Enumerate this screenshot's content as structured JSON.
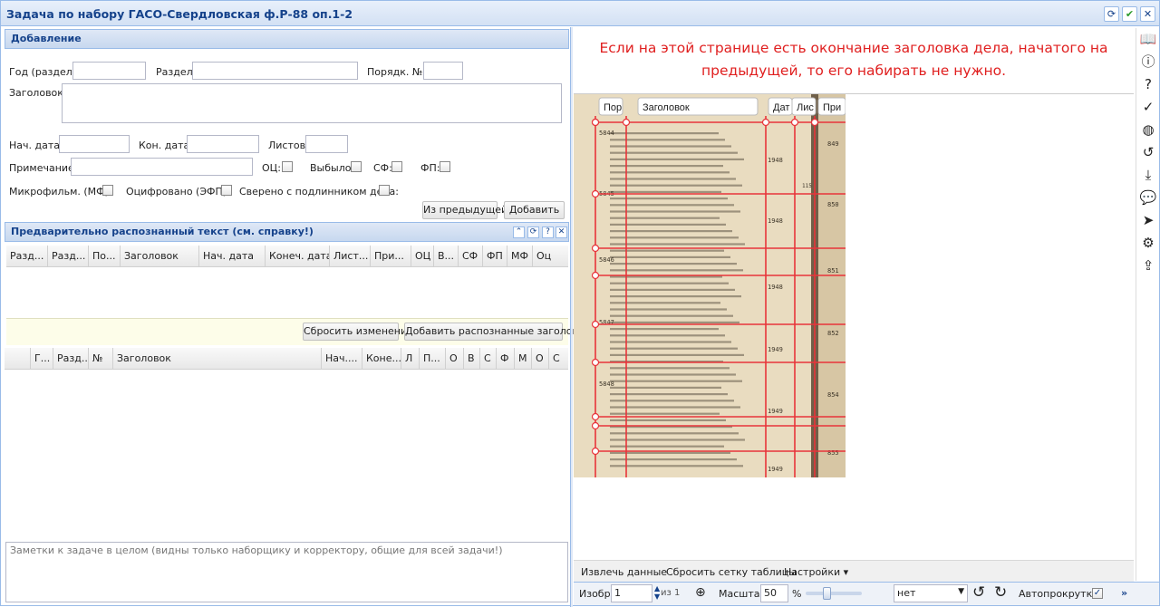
{
  "window": {
    "title": "Задача по набору ГАСО-Свердловская ф.Р-88 оп.1-2",
    "refresh": "⟳",
    "ok": "✔",
    "close": "✕"
  },
  "add": {
    "header": "Добавление",
    "year_label": "Год (раздел):",
    "section_label": "Раздел:",
    "order_label": "Порядк. №:",
    "title_label": "Заголовок:",
    "start_label": "Нач. дата:",
    "end_label": "Кон. дата:",
    "sheets_label": "Листов:",
    "note_label": "Примечание:",
    "oc_label": "ОЦ:",
    "gone_label": "Выбыло:",
    "sf_label": "СФ:",
    "fp_label": "ФП:",
    "mf_label": "Микрофильм. (МФ):",
    "efp_label": "Оцифровано (ЭФП):",
    "verified_label": "Сверено с подлинником дела:",
    "from_prev": "Из предыдущей",
    "add_btn": "Добавить"
  },
  "recognized": {
    "header": "Предварительно распознанный текст (см. справку!)",
    "columns": [
      "Разд...",
      "Разд...",
      "По...",
      "Заголовок",
      "Нач. дата",
      "Конеч. дата",
      "Лист...",
      "При...",
      "ОЦ",
      "В...",
      "СФ",
      "ФП",
      "МФ",
      "Оц"
    ],
    "reset": "Сбросить изменения",
    "add_recognized": "Добавить распознанные заголовки"
  },
  "list": {
    "columns": [
      "Г...",
      "Разд...",
      "№",
      "Заголовок",
      "Нач....",
      "Коне...",
      "Л",
      "П...",
      "О",
      "В",
      "С",
      "Ф",
      "М",
      "О",
      "С"
    ]
  },
  "notes": {
    "placeholder": "Заметки к задаче в целом (видны только наборщику и корректору, общие для всей задачи!)"
  },
  "notice": {
    "line1": "Если на этой странице есть окончание заголовка дела, начатого на",
    "line2": "предыдущей, то его набирать не нужно."
  },
  "image": {
    "col_labels": [
      "Пор",
      "Заголовок",
      "Дат",
      "Лис",
      "При"
    ],
    "entries": [
      {
        "num": "5844",
        "year": "1948",
        "sheets": "115",
        "ref": "849"
      },
      {
        "num": "5845",
        "year": "1948",
        "sheets": "",
        "ref": "850"
      },
      {
        "num": "5846",
        "year": "1948",
        "sheets": "",
        "ref": "851"
      },
      {
        "num": "5847",
        "year": "1949",
        "sheets": "",
        "ref": "852"
      },
      {
        "num": "5848",
        "year": "1949",
        "sheets": "",
        "ref": "854"
      },
      {
        "num": "",
        "year": "1949",
        "sheets": "",
        "ref": "855"
      }
    ]
  },
  "toolbar": {
    "extract": "Извлечь данные",
    "reset_grid": "Сбросить сетку таблицы",
    "settings": "Настройки ▾"
  },
  "nav": {
    "image_label": "Изобр.",
    "page": "1",
    "of": "из 1",
    "scale_label": "Масштаб",
    "scale": "50",
    "percent": "%",
    "rotate_select": "нет",
    "autoscroll": "Автопрокрутка:",
    "more": "»"
  },
  "colors": {
    "accent": "#15428b",
    "border": "#99bbe8",
    "notice": "#e02020",
    "grid": "#e8343a"
  }
}
